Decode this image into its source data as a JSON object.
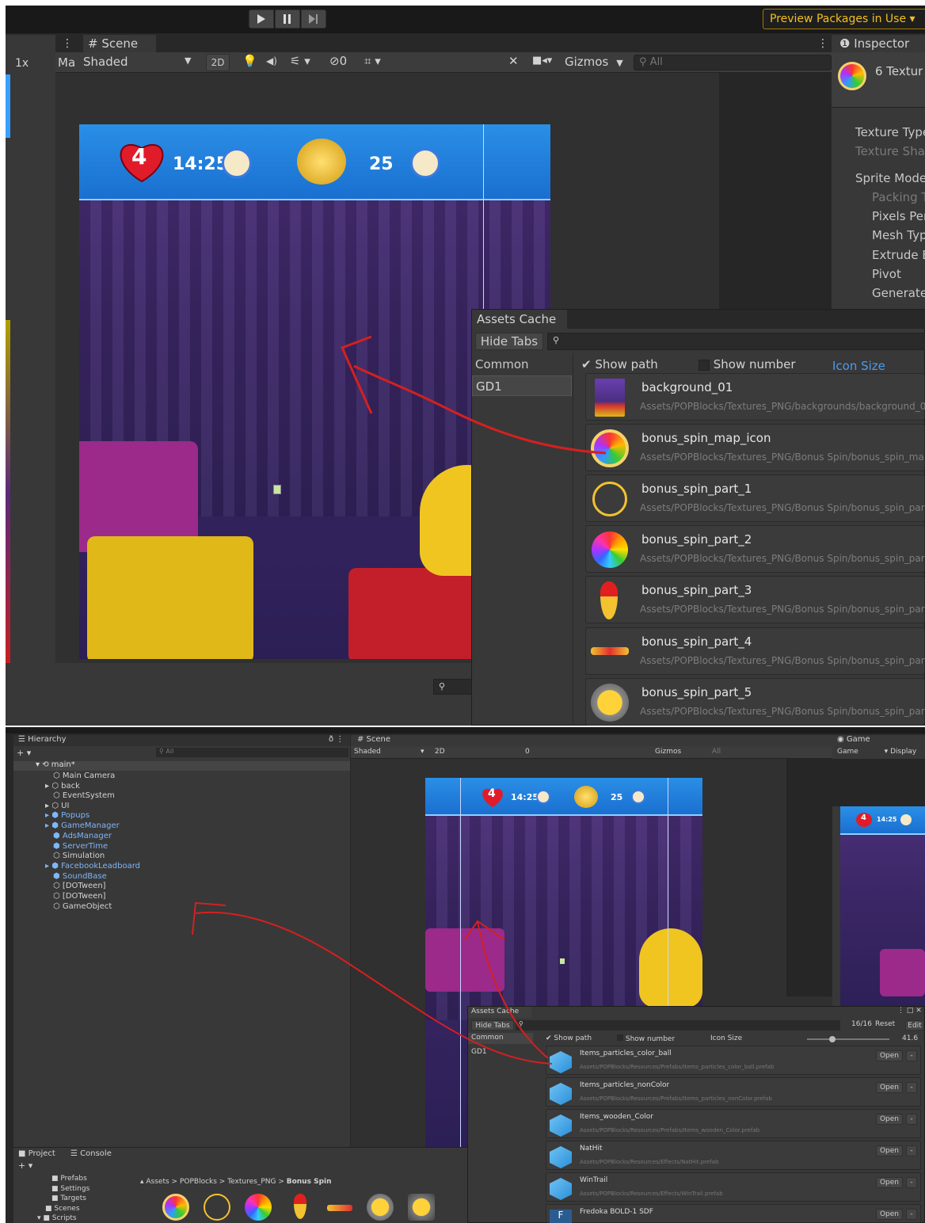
{
  "top": {
    "toolbar": {
      "preview_packages": "Preview Packages in Use ▾"
    },
    "scene_tab": {
      "label": "# Scene",
      "shading": "Shaded",
      "mode_2d": "2D",
      "fx_count": "0",
      "gizmos": "Gizmos",
      "search_placeholder": "All"
    },
    "left_strip": {
      "zoom": "1x",
      "ma": "Ma"
    },
    "hud": {
      "lives": "4",
      "timer": "14:25",
      "coins": "25"
    },
    "inspector": {
      "tab": "Inspector",
      "header": "6 Textur",
      "fields": [
        "Texture Type",
        "Texture Shap",
        "Sprite Mode",
        "Packing Ta",
        "Pixels Per",
        "Mesh Type",
        "Extrude Ed",
        "Pivot",
        "Generate P"
      ]
    },
    "assets_cache": {
      "title": "Assets Cache",
      "hide_tabs": "Hide Tabs",
      "categories": [
        "Common",
        "GD1"
      ],
      "show_path": "Show path",
      "show_number": "Show number",
      "icon_size": "Icon Size",
      "items": [
        {
          "name": "background_01",
          "path": "Assets/POPBlocks/Textures_PNG/backgrounds/background_0"
        },
        {
          "name": "bonus_spin_map_icon",
          "path": "Assets/POPBlocks/Textures_PNG/Bonus Spin/bonus_spin_map"
        },
        {
          "name": "bonus_spin_part_1",
          "path": "Assets/POPBlocks/Textures_PNG/Bonus Spin/bonus_spin_par"
        },
        {
          "name": "bonus_spin_part_2",
          "path": "Assets/POPBlocks/Textures_PNG/Bonus Spin/bonus_spin_par"
        },
        {
          "name": "bonus_spin_part_3",
          "path": "Assets/POPBlocks/Textures_PNG/Bonus Spin/bonus_spin_par"
        },
        {
          "name": "bonus_spin_part_4",
          "path": "Assets/POPBlocks/Textures_PNG/Bonus Spin/bonus_spin_par"
        },
        {
          "name": "bonus_spin_part_5",
          "path": "Assets/POPBlocks/Textures_PNG/Bonus Spin/bonus_spin_par"
        }
      ]
    }
  },
  "bottom": {
    "hierarchy": {
      "tab": "Hierarchy",
      "search_placeholder": "All",
      "root": "main*",
      "items": [
        "Main Camera",
        "back",
        "EventSystem",
        "UI",
        "Popups",
        "GameManager",
        "AdsManager",
        "ServerTime",
        "Simulation",
        "FacebookLeadboard",
        "SoundBase",
        "[DOTween]",
        "[DOTween]",
        "GameObject"
      ]
    },
    "scene_tab": {
      "label": "# Scene",
      "shading": "Shaded",
      "mode_2d": "2D",
      "fx_count": "0",
      "gizmos": "Gizmos",
      "search_placeholder": "All"
    },
    "game_tab": {
      "label": "Game",
      "display_dropdown": "Game",
      "display": "Display"
    },
    "hud": {
      "lives": "4",
      "timer": "14:25",
      "coins": "25"
    },
    "assets_cache": {
      "title": "Assets Cache",
      "hide_tabs": "Hide Tabs",
      "categories": [
        "Common",
        "GD1"
      ],
      "count": "16/16",
      "reset": "Reset",
      "edit": "Edit",
      "show_path": "Show path",
      "show_number": "Show number",
      "icon_size": "Icon Size",
      "icon_size_value": "41.6",
      "open_label": "Open",
      "minus_label": "-",
      "items": [
        {
          "name": "Items_particles_color_ball",
          "path": "Assets/POPBlocks/Resources/Prefabs/Items_particles_color_ball.prefab"
        },
        {
          "name": "Items_particles_nonColor",
          "path": "Assets/POPBlocks/Resources/Prefabs/Items_particles_nonColor.prefab"
        },
        {
          "name": "Items_wooden_Color",
          "path": "Assets/POPBlocks/Resources/Prefabs/Items_wooden_Color.prefab"
        },
        {
          "name": "NatHit",
          "path": "Assets/POPBlocks/Resources/Effects/NatHit.prefab"
        },
        {
          "name": "WinTrail",
          "path": "Assets/POPBlocks/Resources/Effects/WinTrail.prefab"
        },
        {
          "name": "Fredoka BOLD-1 SDF",
          "path": ""
        }
      ]
    },
    "project": {
      "tab": "Project",
      "console_tab": "Console",
      "folders": [
        "Prefabs",
        "Settings",
        "Targets",
        "Scenes",
        "Scripts"
      ],
      "breadcrumb": [
        "Assets",
        "POPBlocks",
        "Textures_PNG",
        "Bonus Spin"
      ]
    }
  },
  "colors": {
    "accent_blue": "#4c9bea",
    "annotation_red": "#d42020",
    "panel": "#383838",
    "gold": "#f2c230"
  }
}
